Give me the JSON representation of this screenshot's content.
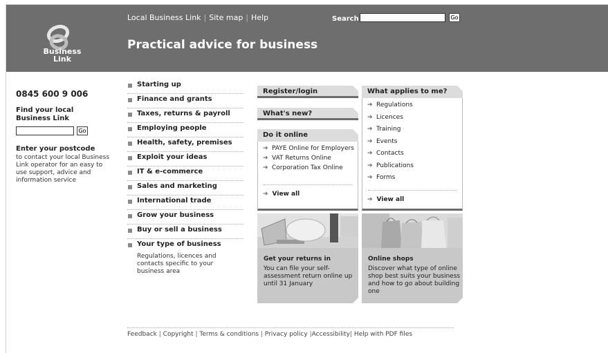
{
  "header": {
    "logo_text_line1": "Business",
    "logo_text_line2": "Link",
    "links": [
      "Local Business Link",
      "Site map",
      "Help"
    ],
    "search_label": "Search",
    "search_value": "",
    "go_label": "Go",
    "tagline": "Practical advice for business",
    "bg_color": "#6e6e6e"
  },
  "left": {
    "phone": "0845 600 9 006",
    "find_title": "Find your local Business Link",
    "find_value": "",
    "go_label": "Go",
    "postcode_title": "Enter your postcode",
    "postcode_desc": "to contact your local Business Link operator for an easy to use support, advice and information service"
  },
  "nav": {
    "items": [
      "Starting up",
      "Finance and grants",
      "Taxes, returns & payroll",
      "Employing people",
      "Health, safety, premises",
      "Exploit your ideas",
      "IT & e-commerce",
      "Sales and marketing",
      "International trade",
      "Grow your business",
      "Buy or sell a business"
    ],
    "last_item": "Your type of business",
    "last_desc": "Regulations, licences and contacts specific to your business area"
  },
  "middle": {
    "register": "Register/login",
    "whats_new": "What's new?",
    "do_online": {
      "title": "Do it online",
      "items": [
        "PAYE Online for Employers",
        "VAT Returns Online",
        "Corporation Tax Online"
      ],
      "view_all": "View all"
    },
    "promo": {
      "title": "Get your returns in",
      "text": "You can file your self-assessment return online up until 31 January"
    }
  },
  "right": {
    "title": "What applies to me?",
    "items": [
      "Regulations",
      "Licences",
      "Training",
      "Events",
      "Contacts",
      "Publications",
      "Forms"
    ],
    "view_all": "View all",
    "promo": {
      "title": "Online shops",
      "text": "Discover what type of online shop best suits your business and how to go about building one"
    }
  },
  "footer": {
    "links": [
      "Feedback",
      "Copyright",
      "Terms & conditions",
      "Privacy policy",
      "Accessibility",
      "Help with PDF files"
    ]
  },
  "icons": {
    "arrow": "arrow-right-icon",
    "bullet": "square-bullet-icon"
  }
}
